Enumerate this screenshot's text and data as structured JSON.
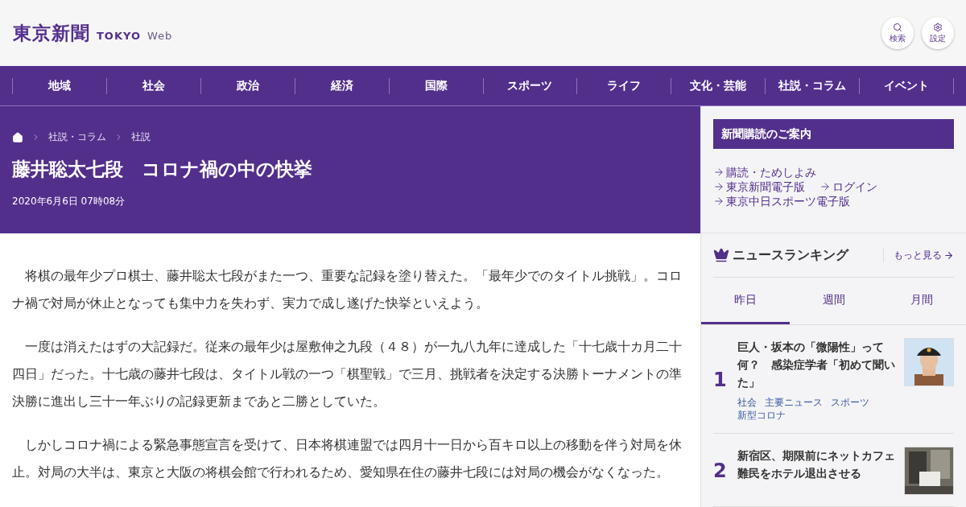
{
  "header": {
    "logo": "東京新聞",
    "logo_sub_1": "TOKYO",
    "logo_sub_2": "Web",
    "buttons": [
      {
        "kind": "search",
        "label": "検索"
      },
      {
        "kind": "settings",
        "label": "設定"
      }
    ]
  },
  "nav": [
    "地域",
    "社会",
    "政治",
    "経済",
    "国際",
    "スポーツ",
    "ライフ",
    "文化・芸能",
    "社説・コラム",
    "イベント"
  ],
  "breadcrumb": [
    "社説・コラム",
    "社説"
  ],
  "article": {
    "title": "藤井聡太七段　コロナ禍の中の快挙",
    "date": "2020年6月6日 07時08分",
    "paragraphs": [
      "将棋の最年少プロ棋士、藤井聡太七段がまた一つ、重要な記録を塗り替えた。「最年少でのタイトル挑戦」。コロナ禍で対局が休止となっても集中力を失わず、実力で成し遂げた快挙といえよう。",
      "一度は消えたはずの大記録だ。従来の最年少は屋敷伸之九段（４８）が一九八九年に達成した「十七歳十カ月二十四日」だった。十七歳の藤井七段は、タイトル戦の一つ「棋聖戦」で三月、挑戦者を決定する決勝トーナメントの準決勝に進出し三十一年ぶりの記録更新まであと二勝としていた。",
      "しかしコロナ禍による緊急事態宣言を受けて、日本将棋連盟では四月十一日から百キロ以上の移動を伴う対局を休止。対局の大半は、東京と大阪の将棋会館で行われるため、愛知県在住の藤井七段には対局の機会がなくなった。"
    ]
  },
  "subscription": {
    "title": "新聞購読のご案内",
    "links": [
      [
        "購読・ためしよみ"
      ],
      [
        "東京新聞電子版",
        "ログイン"
      ],
      [
        "東京中日スポーツ電子版"
      ]
    ]
  },
  "ranking": {
    "title": "ニュースランキング",
    "more": "もっと見る",
    "tabs": [
      {
        "label": "昨日",
        "selected": true
      },
      {
        "label": "週間",
        "selected": false
      },
      {
        "label": "月間",
        "selected": false
      }
    ],
    "items": [
      {
        "rank": "1",
        "title": "巨人・坂本の「微陽性」って何？　感染症学者「初めて聞いた」",
        "tags": [
          "社会",
          "主要ニュース",
          "スポーツ",
          "新型コロナ"
        ]
      },
      {
        "rank": "2",
        "title": "新宿区、期限前にネットカフェ難民をホテル退出させる"
      }
    ]
  }
}
